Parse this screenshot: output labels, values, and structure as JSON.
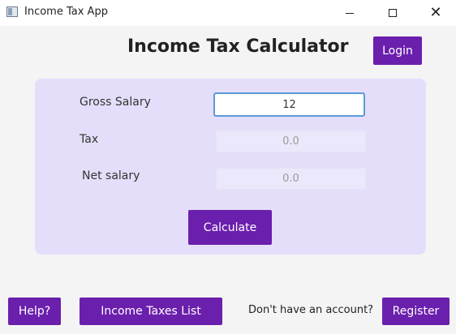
{
  "window": {
    "title": "Income Tax App",
    "minimize_symbol": "—",
    "maximize_symbol": "☐",
    "close_symbol": "✕"
  },
  "header": {
    "title": "Income Tax Calculator",
    "login_label": "Login"
  },
  "form": {
    "gross_label": "Gross Salary",
    "gross_value": "12",
    "tax_label": "Tax",
    "tax_value": "0.0",
    "net_label": "Net salary",
    "net_value": "0.0",
    "calculate_label": "Calculate"
  },
  "footer": {
    "help_label": "Help?",
    "list_label": "Income Taxes List",
    "no_account_text": "Don't have an account?",
    "register_label": "Register"
  },
  "colors": {
    "accent": "#6b1fad",
    "card_background": "#e4defa",
    "focus_border": "#5a9ad6"
  },
  "icons": [
    "app-window-icon",
    "minimize-icon",
    "maximize-icon",
    "close-icon"
  ]
}
